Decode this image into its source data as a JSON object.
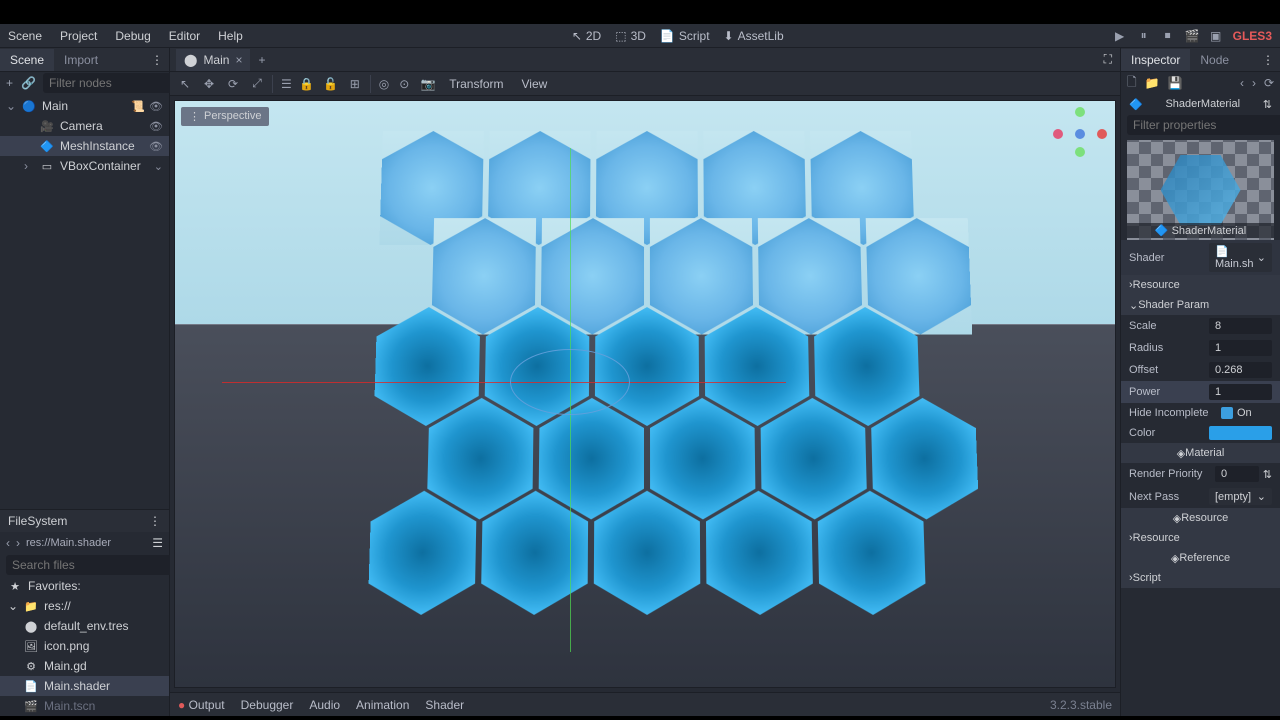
{
  "menu": {
    "items": [
      "Scene",
      "Project",
      "Debug",
      "Editor",
      "Help"
    ]
  },
  "centerTabs": [
    "2D",
    "3D",
    "Script",
    "AssetLib"
  ],
  "renderer": "GLES3",
  "leftTabs": {
    "scene": "Scene",
    "import": "Import"
  },
  "filterNodes": "Filter nodes",
  "sceneTree": [
    {
      "name": "Main",
      "icon": "🔵",
      "indent": 0,
      "chev": "⌄"
    },
    {
      "name": "Camera",
      "icon": "🎥",
      "indent": 1
    },
    {
      "name": "MeshInstance",
      "icon": "🔷",
      "indent": 1,
      "selected": true
    },
    {
      "name": "VBoxContainer",
      "icon": "▭",
      "indent": 1,
      "chev": "›"
    }
  ],
  "filesystem": {
    "title": "FileSystem",
    "path": "res://Main.shader",
    "search": "Search files",
    "favorites": "Favorites:",
    "root": "res://",
    "files": [
      {
        "name": "default_env.tres",
        "icon": "⬤"
      },
      {
        "name": "icon.png",
        "icon": "🖼"
      },
      {
        "name": "Main.gd",
        "icon": "⚙"
      },
      {
        "name": "Main.shader",
        "icon": "📄",
        "selected": true
      },
      {
        "name": "Main.tscn",
        "icon": "🎬",
        "fade": true
      }
    ]
  },
  "sceneTabs": {
    "main": "Main"
  },
  "viewToolbar": {
    "transform": "Transform",
    "view": "View"
  },
  "perspective": "Perspective",
  "bottom": {
    "items": [
      "Output",
      "Debugger",
      "Audio",
      "Animation",
      "Shader"
    ],
    "version": "3.2.3.stable"
  },
  "inspector": {
    "tabs": {
      "inspector": "Inspector",
      "node": "Node"
    },
    "breadcrumb": "ShaderMaterial",
    "previewLabel": "ShaderMaterial",
    "filterProps": "Filter properties",
    "shader": {
      "label": "Shader",
      "value": "Main.sh"
    },
    "groups": {
      "resource": "Resource",
      "shaderParam": "Shader Param",
      "material": "Material",
      "resource2": "Resource",
      "reference": "Reference",
      "script": "Script"
    },
    "params": {
      "scale": {
        "label": "Scale",
        "value": "8"
      },
      "radius": {
        "label": "Radius",
        "value": "1"
      },
      "offset": {
        "label": "Offset",
        "value": "0.268"
      },
      "power": {
        "label": "Power",
        "value": "1"
      },
      "hideIncomplete": {
        "label": "Hide Incomplete",
        "value": "On"
      },
      "color": {
        "label": "Color"
      }
    },
    "renderPriority": {
      "label": "Render Priority",
      "value": "0"
    },
    "nextPass": {
      "label": "Next Pass",
      "value": "[empty]"
    }
  }
}
